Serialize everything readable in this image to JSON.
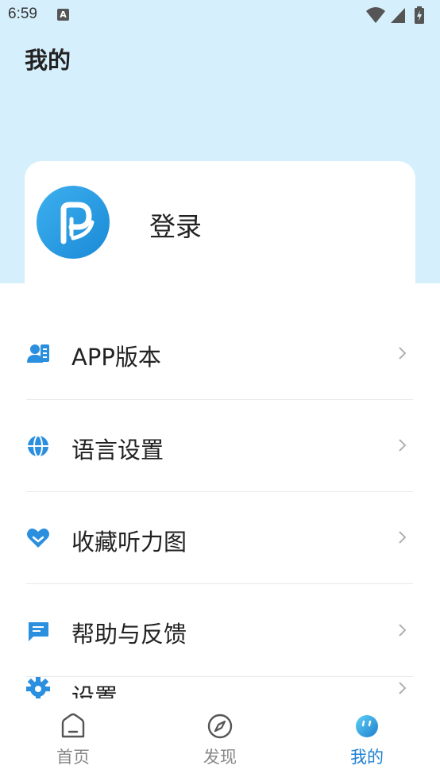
{
  "status_bar": {
    "time": "6:59",
    "notification_letter": "A"
  },
  "page": {
    "title": "我的"
  },
  "profile": {
    "login_label": "登录"
  },
  "menu": {
    "items": [
      {
        "label": "APP版本",
        "icon": "contact-card-icon"
      },
      {
        "label": "语言设置",
        "icon": "globe-icon"
      },
      {
        "label": "收藏听力图",
        "icon": "heart-icon"
      },
      {
        "label": "帮助与反馈",
        "icon": "chat-bubble-icon"
      },
      {
        "label": "设置",
        "icon": "gear-icon"
      }
    ]
  },
  "bottom_nav": {
    "items": [
      {
        "label": "首页",
        "icon": "home-icon",
        "active": false
      },
      {
        "label": "发现",
        "icon": "compass-icon",
        "active": false
      },
      {
        "label": "我的",
        "icon": "mine-icon",
        "active": true
      }
    ]
  },
  "colors": {
    "accent": "#1d7fd0",
    "header_bg": "#d6effc",
    "icon_blue": "#2b8fe0"
  }
}
